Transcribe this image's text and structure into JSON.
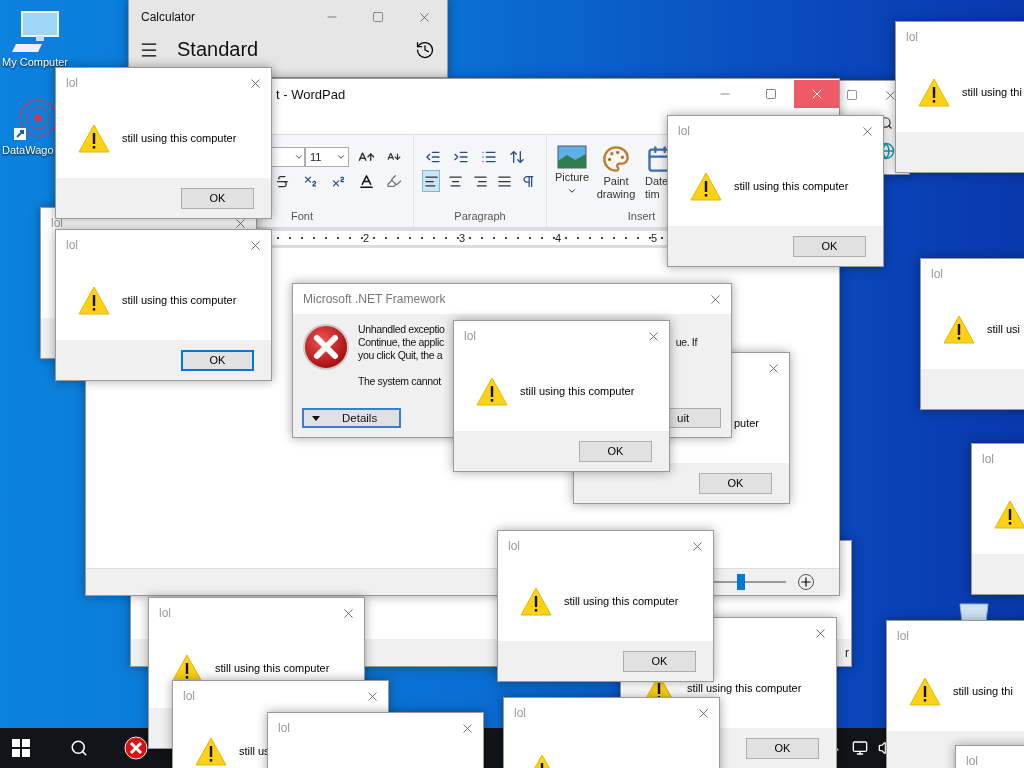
{
  "desktop_icons": [
    {
      "label": "My Computer"
    },
    {
      "label": "DataWago"
    }
  ],
  "calculator": {
    "title": "Calculator",
    "mode": "Standard"
  },
  "bottom_window": {
    "text": "r"
  },
  "wordpad": {
    "title": "t - WordPad",
    "font_size": "11",
    "font_group": "Font",
    "paragraph_group": "Paragraph",
    "insert_group": "Insert",
    "align_buttons": [
      {
        "selected": true
      },
      {
        "selected": false
      },
      {
        "selected": false
      },
      {
        "selected": false
      }
    ],
    "insert_items": [
      {
        "label": "Picture"
      },
      {
        "label": "Paint drawing"
      },
      {
        "label": "Date tim"
      }
    ],
    "ruler": [
      "2",
      "3",
      "4",
      "5"
    ],
    "zoom": {
      "level": 0.4
    }
  },
  "net_dialog": {
    "title": "Microsoft .NET Framework",
    "message_lines": [
      {
        "text": "Unhandled exceptio"
      },
      {
        "text": "Continue, the applic",
        "right_fragment": "ue. If"
      },
      {
        "text": "you click Quit, the a"
      },
      {
        "text": "The system cannot"
      }
    ],
    "buttons": [
      {
        "label": "Details",
        "focused": true
      },
      {
        "label": "uit",
        "focused": false
      }
    ]
  },
  "dialogs": [
    {
      "title": "lol"
    },
    {
      "title": "lol",
      "message": "still using this computer",
      "ok": {
        "label": "OK",
        "focused": false
      }
    },
    {
      "title": "lol",
      "message": "still using this computer",
      "ok": {
        "label": "OK",
        "focused": true
      }
    },
    {
      "message": "puter",
      "ok": {
        "label": "OK",
        "focused": false
      }
    },
    {
      "title": "lol",
      "message": "still using this computer",
      "ok": {
        "label": "OK",
        "focused": false
      }
    },
    {
      "title": "lol",
      "message": "still using this computer",
      "ok": {
        "label": "OK",
        "focused": false
      }
    },
    {
      "title": "lol",
      "message": "still using thi"
    },
    {
      "title": "lol",
      "message": "still usi"
    },
    {
      "title": "lol"
    },
    {
      "message": "still using this computer",
      "ok": {
        "label": "OK",
        "focused": false
      }
    },
    {
      "title": "lol",
      "message": "still using this computer",
      "ok": {
        "label": "OK",
        "focused": false
      }
    },
    {
      "title": "lol",
      "message": "still using this computer"
    },
    {
      "title": "lol",
      "message": "still us"
    },
    {
      "title": "lol"
    },
    {
      "title": "lol"
    },
    {
      "title": "lol",
      "message": "still using thi"
    },
    {
      "title": "lol"
    }
  ]
}
